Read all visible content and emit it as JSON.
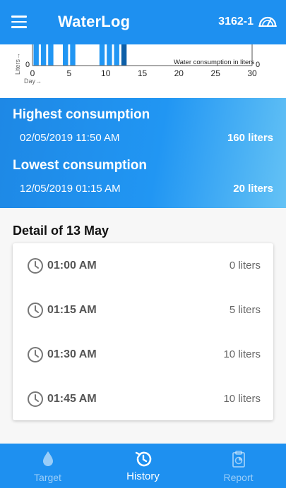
{
  "app": {
    "title": "WaterLog",
    "device_id": "3162-1",
    "accent_color": "#1e90f0"
  },
  "icons": {
    "menu": "menu-icon",
    "meter": "meter-icon",
    "clock": "clock-icon",
    "target": "water-drop-icon",
    "history": "history-icon",
    "report": "report-icon"
  },
  "chart_data": {
    "type": "bar",
    "ylabel": "Liters→",
    "xlabel": "Day→",
    "annotation": "Water consumption in liters",
    "y_origin_left": "0",
    "y_origin_right": "0",
    "x_ticks": [
      "0",
      "5",
      "10",
      "15",
      "20",
      "25",
      "30"
    ],
    "xlim": [
      0,
      30
    ],
    "highlight_day": 13,
    "bar_color": "#2196f3",
    "highlight_color": "#0d5fa8",
    "days_with_data": [
      1,
      2,
      3,
      5,
      6,
      10,
      11,
      12,
      13
    ]
  },
  "summary": {
    "highest": {
      "label": "Highest consumption",
      "datetime": "02/05/2019 11:50 AM",
      "amount": "160 liters"
    },
    "lowest": {
      "label": "Lowest consumption",
      "datetime": "12/05/2019 01:15 AM",
      "amount": "20 liters"
    }
  },
  "detail": {
    "title": "Detail of 13 May",
    "rows": [
      {
        "time": "01:00 AM",
        "liters": "0 liters"
      },
      {
        "time": "01:15 AM",
        "liters": "5 liters"
      },
      {
        "time": "01:30 AM",
        "liters": "10 liters"
      },
      {
        "time": "01:45 AM",
        "liters": "10 liters"
      }
    ]
  },
  "nav": {
    "target": "Target",
    "history": "History",
    "report": "Report",
    "active": "history"
  }
}
